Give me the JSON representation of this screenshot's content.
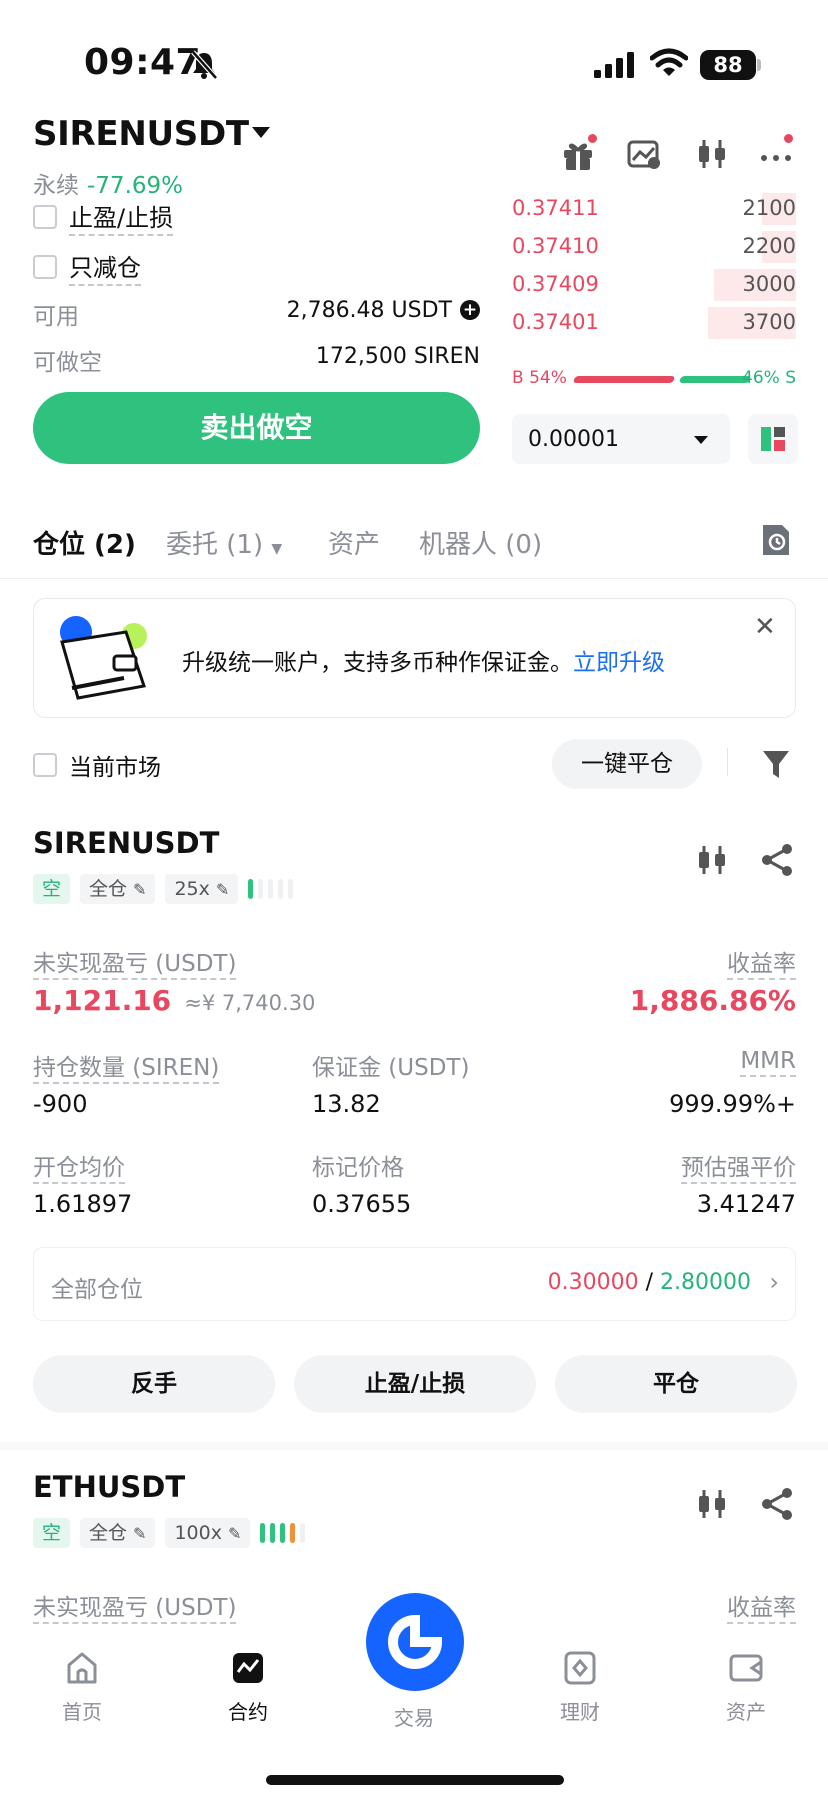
{
  "status_bar": {
    "time": "09:47",
    "battery": "88"
  },
  "header": {
    "symbol": "SIRENUSDT",
    "contract_type": "永续",
    "change_pct": "-77.69%"
  },
  "order_form": {
    "tp_sl_label": "止盈/止损",
    "reduce_only_label": "只减仓",
    "available_label": "可用",
    "available_value": "2,786.48 USDT",
    "max_short_label": "可做空",
    "max_short_value": "172,500 SIREN",
    "sell_button": "卖出做空"
  },
  "order_book": {
    "asks": [
      {
        "price": "0.37411",
        "qty": "2100",
        "depth": 0.12
      },
      {
        "price": "0.37410",
        "qty": "2200",
        "depth": 0.12
      },
      {
        "price": "0.37409",
        "qty": "3000",
        "depth": 0.29
      },
      {
        "price": "0.37401",
        "qty": "3700",
        "depth": 0.31
      }
    ],
    "buy_ratio": "B 54%",
    "sell_ratio": "46% S",
    "tick_size": "0.00001"
  },
  "tabs": [
    "仓位 (2)",
    "委托 (1)",
    "资产",
    "机器人 (0)"
  ],
  "banner": {
    "text": "升级统一账户，支持多币种作保证金。",
    "link": "立即升级"
  },
  "filters": {
    "current_market": "当前市场",
    "close_all": "一键平仓"
  },
  "positions": [
    {
      "symbol": "SIRENUSDT",
      "side": "空",
      "margin_mode": "全仓",
      "leverage": "25x",
      "unrealized_label": "未实现盈亏 (USDT)",
      "unrealized_value": "1,121.16",
      "unrealized_cny": "≈¥ 7,740.30",
      "roe_label": "收益率",
      "roe_value": "1,886.86%",
      "size_label": "持仓数量 (SIREN)",
      "size_value": "-900",
      "margin_label": "保证金 (USDT)",
      "margin_value": "13.82",
      "mmr_label": "MMR",
      "mmr_value": "999.99%+",
      "entry_label": "开仓均价",
      "entry_value": "1.61897",
      "mark_label": "标记价格",
      "mark_value": "0.37655",
      "liq_label": "预估强平价",
      "liq_value": "3.41247",
      "all_positions_label": "全部仓位",
      "tp_value": "0.30000",
      "sl_value": "2.80000",
      "actions": [
        "反手",
        "止盈/止损",
        "平仓"
      ]
    },
    {
      "symbol": "ETHUSDT",
      "side": "空",
      "margin_mode": "全仓",
      "leverage": "100x",
      "unrealized_label": "未实现盈亏 (USDT)",
      "roe_label": "收益率"
    }
  ],
  "bottom_nav": [
    "首页",
    "合约",
    "交易",
    "理财",
    "资产"
  ]
}
